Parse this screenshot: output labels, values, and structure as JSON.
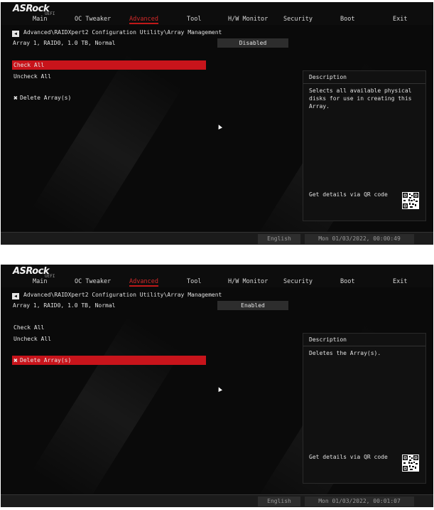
{
  "screens": [
    {
      "logo": "ASRock",
      "logo_sub": "UEFI",
      "tabs": [
        "Main",
        "OC Tweaker",
        "Advanced",
        "Tool",
        "H/W Monitor",
        "Security",
        "Boot",
        "Exit"
      ],
      "active_tab": "Advanced",
      "breadcrumb": "Advanced\\RAIDXpert2 Configuration Utility\\Array Management",
      "array_label": "Array 1, RAID0, 1.0 TB, Normal",
      "array_value": "Disabled",
      "items": [
        "Check All",
        "Uncheck All",
        "Delete Array(s)"
      ],
      "selected_item": "Check All",
      "description_title": "Description",
      "description_text": "Selects all available physical disks for use in creating this Array.",
      "qr_label": "Get details via QR code",
      "language": "English",
      "datetime": "Mon 01/03/2022, 00:00:49"
    },
    {
      "logo": "ASRock",
      "logo_sub": "UEFI",
      "tabs": [
        "Main",
        "OC Tweaker",
        "Advanced",
        "Tool",
        "H/W Monitor",
        "Security",
        "Boot",
        "Exit"
      ],
      "active_tab": "Advanced",
      "breadcrumb": "Advanced\\RAIDXpert2 Configuration Utility\\Array Management",
      "array_label": "Array 1, RAID0, 1.0 TB, Normal",
      "array_value": "Enabled",
      "items": [
        "Check All",
        "Uncheck All",
        "Delete Array(s)"
      ],
      "selected_item": "Delete Array(s)",
      "description_title": "Description",
      "description_text": "Deletes the Array(s).",
      "qr_label": "Get details via QR code",
      "language": "English",
      "datetime": "Mon 01/03/2022, 00:01:07"
    }
  ],
  "colors": {
    "accent": "#c8141b",
    "background": "#0a0a0a",
    "text": "#e6e6e6"
  },
  "icons": {
    "back": "back-arrow-icon",
    "delete": "tools-icon",
    "qr": "qr-code-icon",
    "cursor": "mouse-cursor-icon"
  }
}
